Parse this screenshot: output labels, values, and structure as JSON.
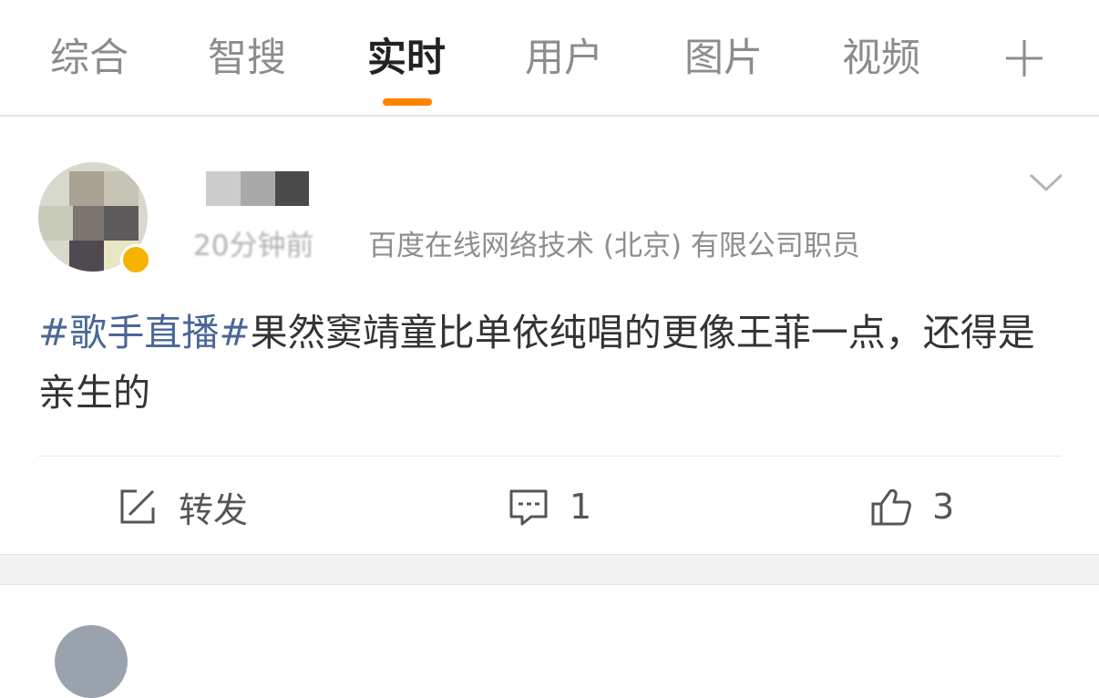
{
  "tabs": [
    {
      "label": "综合"
    },
    {
      "label": "智搜"
    },
    {
      "label": "实时",
      "active": true
    },
    {
      "label": "用户"
    },
    {
      "label": "图片"
    },
    {
      "label": "视频"
    }
  ],
  "colors": {
    "accent": "#ff8200",
    "hashtag": "#4a6796",
    "verified": "#f5b300"
  },
  "post": {
    "time": "20分钟前",
    "source": "百度在线网络技术 (北京) 有限公司职员",
    "hashtag": "#歌手直播#",
    "text": "果然窦靖童比单依纯唱的更像王菲一点，还得是亲生的",
    "actions": {
      "repost_label": "转发",
      "comment_count": "1",
      "like_count": "3"
    }
  },
  "icons": [
    "plus-icon",
    "chevron-down-icon",
    "repost-icon",
    "comment-icon",
    "like-icon",
    "verified-badge-icon"
  ]
}
